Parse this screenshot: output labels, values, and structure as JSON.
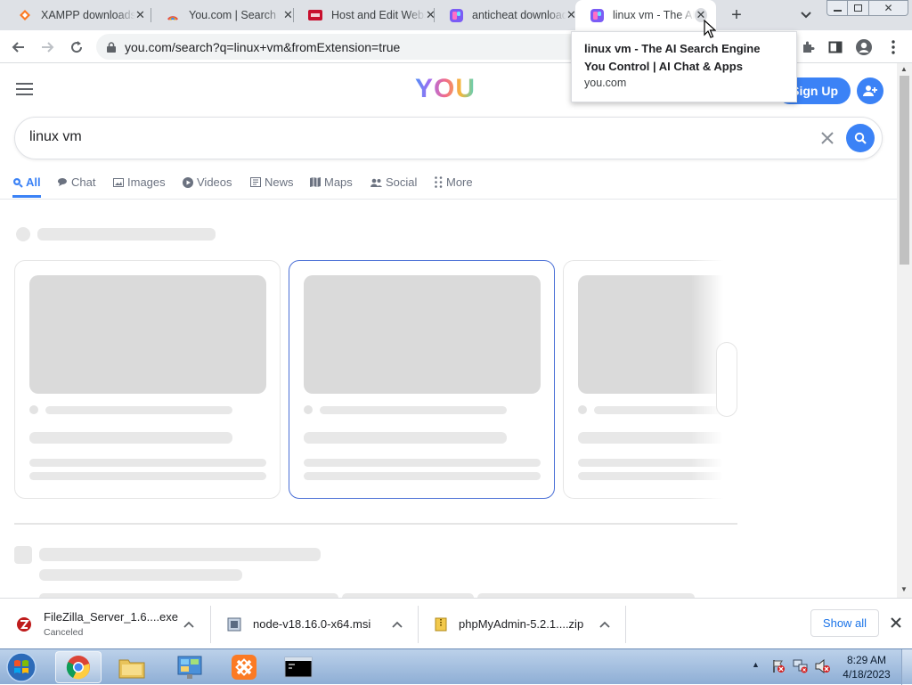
{
  "browser": {
    "tabs": [
      {
        "title": "XAMPP downloads",
        "icon": "xampp-icon",
        "close": "✕"
      },
      {
        "title": "You.com | Search",
        "icon": "youcom-favicon",
        "close": "✕"
      },
      {
        "title": "Host and Edit Websites",
        "icon": "hostedit-icon",
        "close": "✕"
      },
      {
        "title": "anticheat download",
        "icon": "anticheat-icon",
        "close": "✕"
      },
      {
        "title": "linux vm - The AI Search",
        "icon": "youcom-ai-icon",
        "close": "✕"
      }
    ],
    "new_tab": "+",
    "url": "you.com/search?q=linux+vm&fromExtension=true",
    "tooltip": {
      "title": "linux vm - The AI Search Engine You Control | AI Chat & Apps",
      "domain": "you.com"
    }
  },
  "site": {
    "logo": "YOU",
    "signup": "Sign Up",
    "search_value": "linux vm",
    "nav": [
      {
        "label": "All",
        "icon": "search-icon",
        "active": true
      },
      {
        "label": "Chat",
        "icon": "chat-icon"
      },
      {
        "label": "Images",
        "icon": "image-icon"
      },
      {
        "label": "Videos",
        "icon": "video-icon"
      },
      {
        "label": "News",
        "icon": "news-icon"
      },
      {
        "label": "Maps",
        "icon": "map-icon"
      },
      {
        "label": "Social",
        "icon": "people-icon"
      },
      {
        "label": "More",
        "icon": "more-icon"
      }
    ]
  },
  "downloads": {
    "items": [
      {
        "name": "FileZilla_Server_1.6....exe",
        "status": "Canceled",
        "icon": "filezilla-icon"
      },
      {
        "name": "node-v18.16.0-x64.msi",
        "icon": "msi-icon"
      },
      {
        "name": "phpMyAdmin-5.2.1....zip",
        "icon": "zip-icon"
      }
    ],
    "show_all": "Show all"
  },
  "taskbar": {
    "time": "8:29 AM",
    "date": "4/18/2023"
  },
  "colors": {
    "accent": "#3b82f6",
    "tab_bar": "#dee1e6",
    "skeleton": "#e8e8e8"
  }
}
